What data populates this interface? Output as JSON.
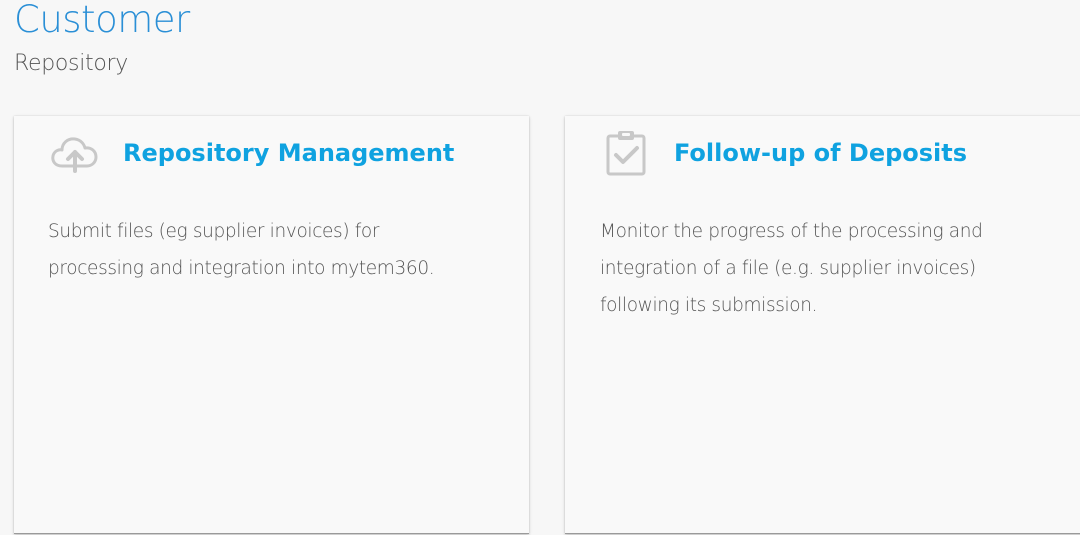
{
  "header": {
    "title": "Customer",
    "subtitle": "Repository"
  },
  "cards": [
    {
      "icon": "cloud-upload-icon",
      "title": "Repository Management",
      "description": "Submit files (eg supplier invoices) for processing and integration into mytem360."
    },
    {
      "icon": "clipboard-check-icon",
      "title": "Follow-up of Deposits",
      "description": "Monitor the progress of the processing and integration of a file (e.g. supplier invoices) following its submission."
    }
  ],
  "colors": {
    "accent": "#0fa2e0",
    "title": "#2a8fd6",
    "text": "#555555",
    "icon": "#c8c8c8",
    "background": "#f7f7f7"
  }
}
